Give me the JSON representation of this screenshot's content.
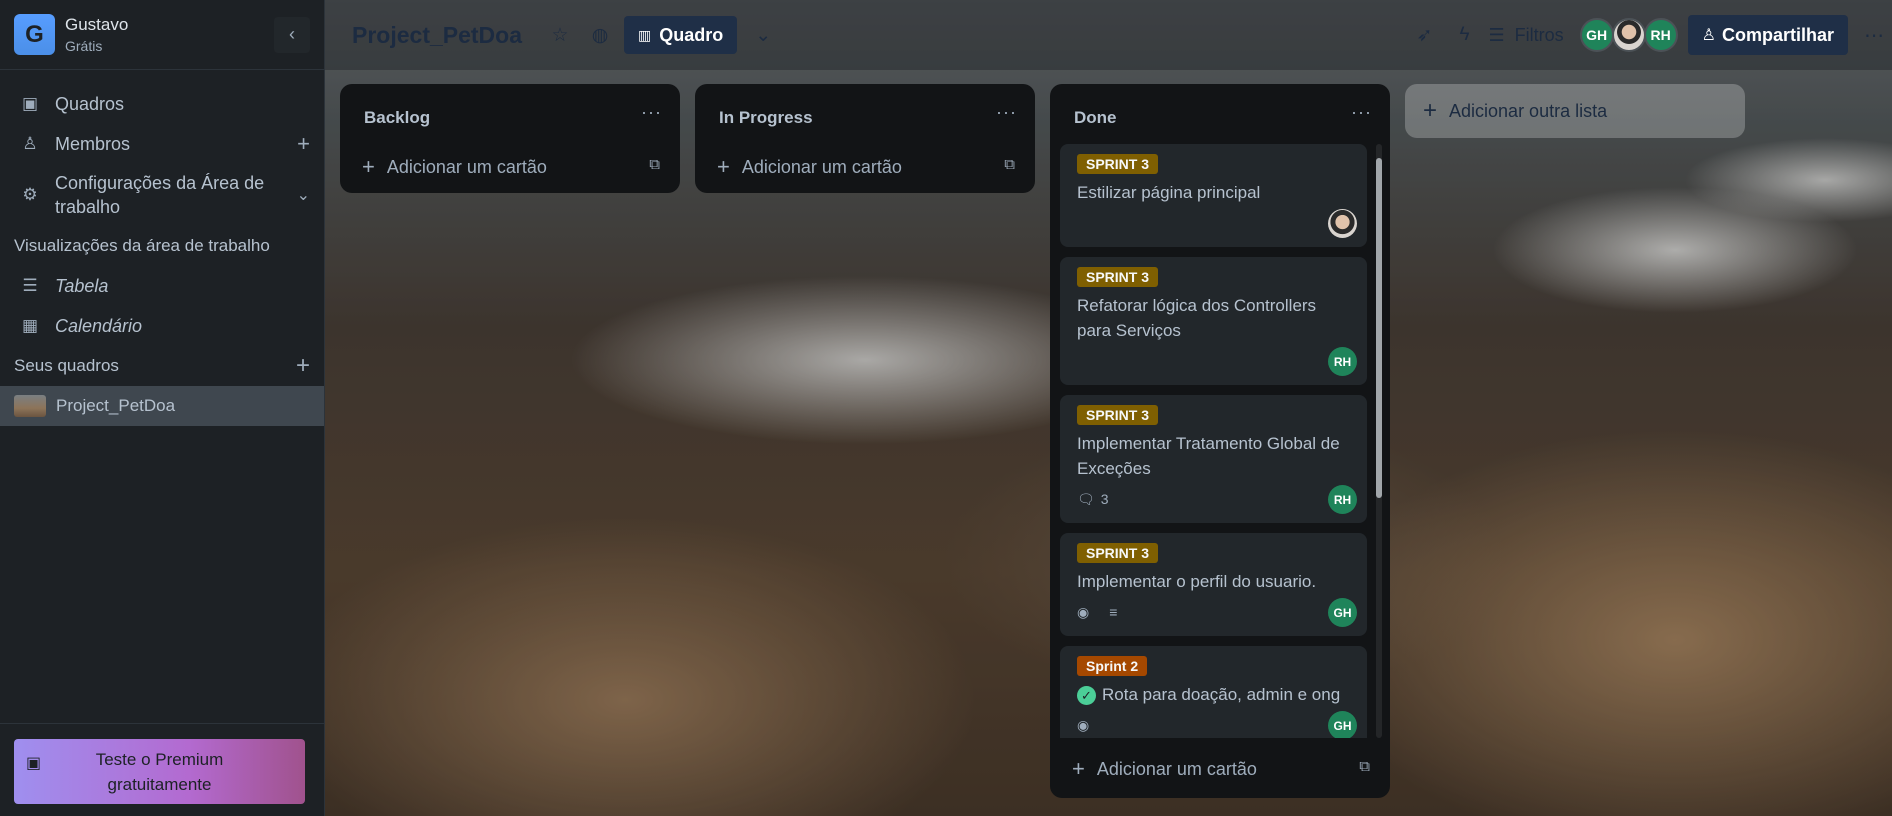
{
  "workspace": {
    "initial": "G",
    "name": "Gustavo",
    "plan": "Grátis"
  },
  "sidebar": {
    "items": [
      {
        "label": "Quadros"
      },
      {
        "label": "Membros"
      },
      {
        "label": "Configurações da Área de trabalho"
      }
    ],
    "views_title": "Visualizações da área de trabalho",
    "views": [
      {
        "label": "Tabela"
      },
      {
        "label": "Calendário"
      }
    ],
    "boards_title": "Seus quadros",
    "boards": [
      {
        "label": "Project_PetDoa"
      }
    ],
    "premium_label": "Teste o Premium gratuitamente"
  },
  "header": {
    "board_title": "Project_PetDoa",
    "view_label": "Quadro",
    "filters_label": "Filtros",
    "members": [
      "GH",
      "RH"
    ],
    "share_label": "Compartilhar"
  },
  "lists": [
    {
      "title": "Backlog",
      "add_card_label": "Adicionar um cartão"
    },
    {
      "title": "In Progress",
      "add_card_label": "Adicionar um cartão"
    },
    {
      "title": "Done",
      "add_card_label": "Adicionar um cartão",
      "cards": [
        {
          "label": "SPRINT 3",
          "title": "Estilizar página principal",
          "member": ""
        },
        {
          "label": "SPRINT 3",
          "title": "Refatorar lógica dos Controllers para Serviços",
          "member": "RH"
        },
        {
          "label": "SPRINT 3",
          "title": "Implementar Tratamento Global de Exceções",
          "comments": "3",
          "member": "RH"
        },
        {
          "label": "SPRINT 3",
          "title": "Implementar o perfil do usuario.",
          "member": "GH"
        },
        {
          "label": "Sprint 2",
          "title": "Rota para doação, admin e ong",
          "member": "GH"
        }
      ]
    }
  ],
  "add_list_label": "Adicionar outra lista",
  "colors": {
    "sprint3": "#7f5f01",
    "sprint2": "#a54800",
    "member_green": "#1f845a",
    "header_button": "#1f2f47"
  }
}
